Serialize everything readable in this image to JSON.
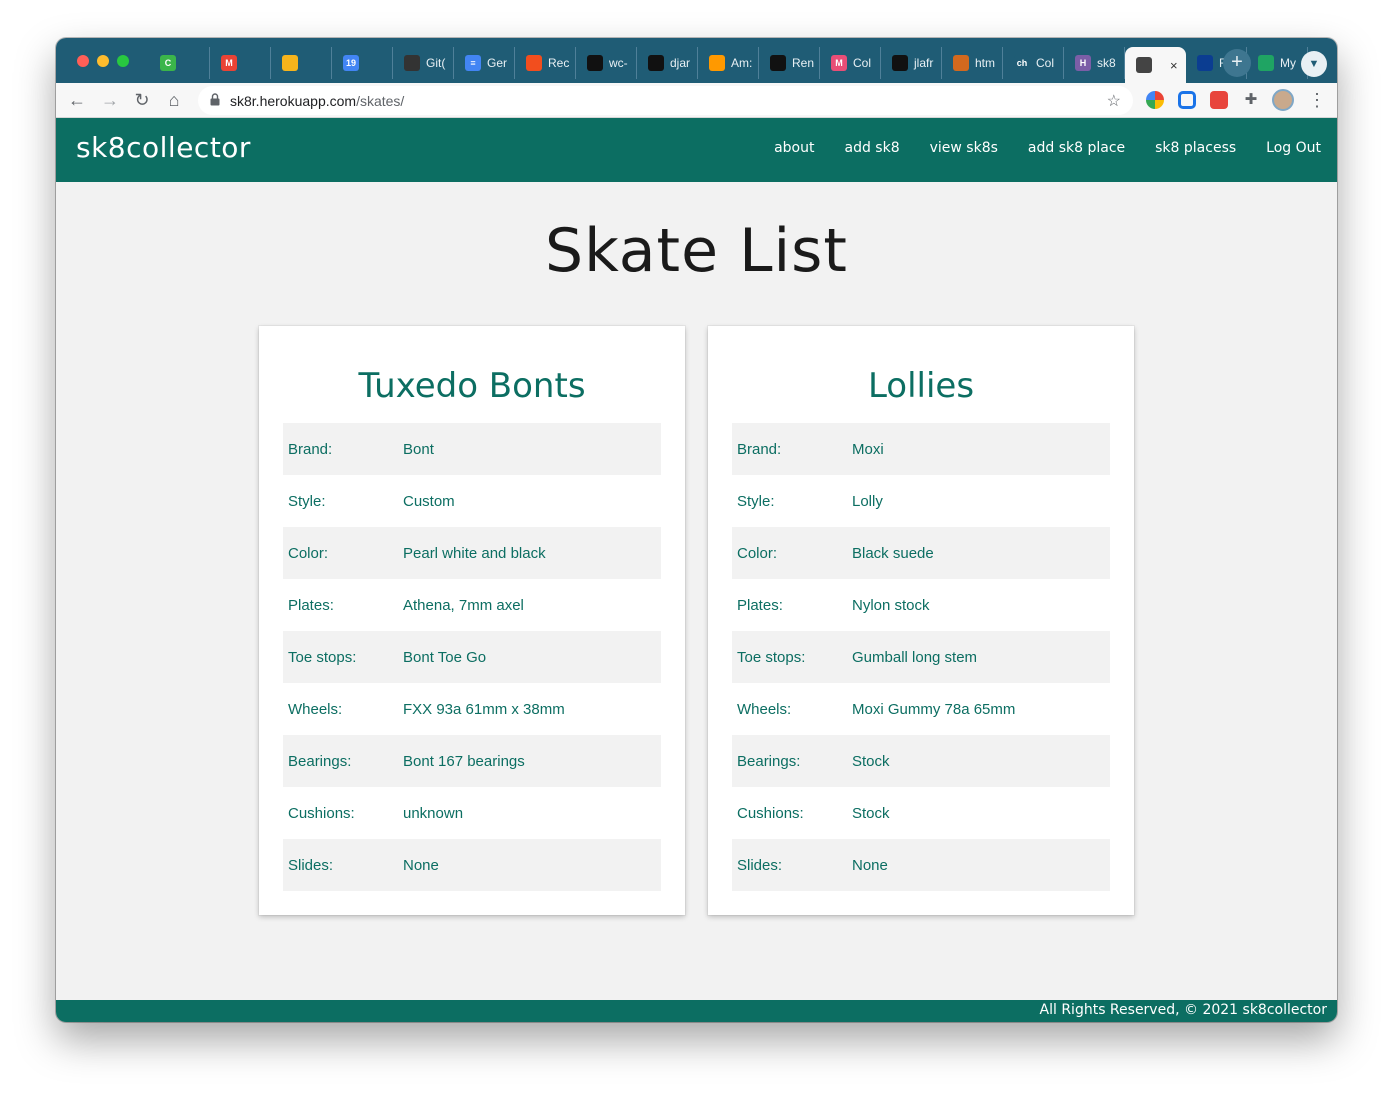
{
  "browser": {
    "tabs": [
      {
        "label": "",
        "favicon_color": "#3bb54a",
        "favicon_text": "C"
      },
      {
        "label": "",
        "favicon_color": "#ea4335",
        "favicon_text": "M"
      },
      {
        "label": "",
        "favicon_color": "#f6b41c",
        "favicon_text": ""
      },
      {
        "label": "",
        "favicon_color": "#4285f4",
        "favicon_text": "19"
      },
      {
        "label": "Git(",
        "favicon_color": "#333333",
        "favicon_text": ""
      },
      {
        "label": "Ger",
        "favicon_color": "#4285f4",
        "favicon_text": "≡"
      },
      {
        "label": "Rec",
        "favicon_color": "#f24e1e",
        "favicon_text": ""
      },
      {
        "label": "wc-",
        "favicon_color": "#111111",
        "favicon_text": ""
      },
      {
        "label": "djar",
        "favicon_color": "#111111",
        "favicon_text": ""
      },
      {
        "label": "Am:",
        "favicon_color": "#ff9900",
        "favicon_text": ""
      },
      {
        "label": "Ren",
        "favicon_color": "#111111",
        "favicon_text": ""
      },
      {
        "label": "Col",
        "favicon_color": "#e94e77",
        "favicon_text": "M"
      },
      {
        "label": "jlafr",
        "favicon_color": "#111111",
        "favicon_text": ""
      },
      {
        "label": "htm",
        "favicon_color": "#d2691e",
        "favicon_text": ""
      },
      {
        "label": "Col",
        "favicon_color": "#1f5c75",
        "favicon_text": "ch"
      },
      {
        "label": "sk8",
        "favicon_color": "#7b5ea7",
        "favicon_text": "H"
      },
      {
        "label": "",
        "favicon_color": "#444444",
        "favicon_text": "",
        "active": true
      },
      {
        "label": "Roll",
        "favicon_color": "#0b3d91",
        "favicon_text": ""
      },
      {
        "label": "My",
        "favicon_color": "#1fa463",
        "favicon_text": ""
      }
    ],
    "active_tab_close": "×",
    "new_tab": "+",
    "url_host": "sk8r.herokuapp.com",
    "url_path": "/skates/"
  },
  "site": {
    "brand": "sk8collector",
    "nav": [
      "about",
      "add sk8",
      "view sk8s",
      "add sk8 place",
      "sk8 placess",
      "Log Out"
    ]
  },
  "page": {
    "title": "Skate List"
  },
  "skates": [
    {
      "name": "Tuxedo Bonts",
      "specs": [
        {
          "label": "Brand:",
          "value": "Bont"
        },
        {
          "label": "Style:",
          "value": "Custom"
        },
        {
          "label": "Color:",
          "value": "Pearl white and black"
        },
        {
          "label": "Plates:",
          "value": "Athena, 7mm axel"
        },
        {
          "label": "Toe stops:",
          "value": "Bont Toe Go"
        },
        {
          "label": "Wheels:",
          "value": "FXX 93a 61mm x 38mm"
        },
        {
          "label": "Bearings:",
          "value": "Bont 167 bearings"
        },
        {
          "label": "Cushions:",
          "value": "unknown"
        },
        {
          "label": "Slides:",
          "value": "None"
        }
      ]
    },
    {
      "name": "Lollies",
      "specs": [
        {
          "label": "Brand:",
          "value": "Moxi"
        },
        {
          "label": "Style:",
          "value": "Lolly"
        },
        {
          "label": "Color:",
          "value": "Black suede"
        },
        {
          "label": "Plates:",
          "value": "Nylon stock"
        },
        {
          "label": "Toe stops:",
          "value": "Gumball long stem"
        },
        {
          "label": "Wheels:",
          "value": "Moxi Gummy 78a 65mm"
        },
        {
          "label": "Bearings:",
          "value": "Stock"
        },
        {
          "label": "Cushions:",
          "value": "Stock"
        },
        {
          "label": "Slides:",
          "value": "None"
        }
      ]
    }
  ],
  "footer": {
    "text": "All Rights Reserved, © 2021 sk8collector"
  },
  "colors": {
    "brand_green": "#0c6e62",
    "tabstrip": "#1f5c75"
  }
}
